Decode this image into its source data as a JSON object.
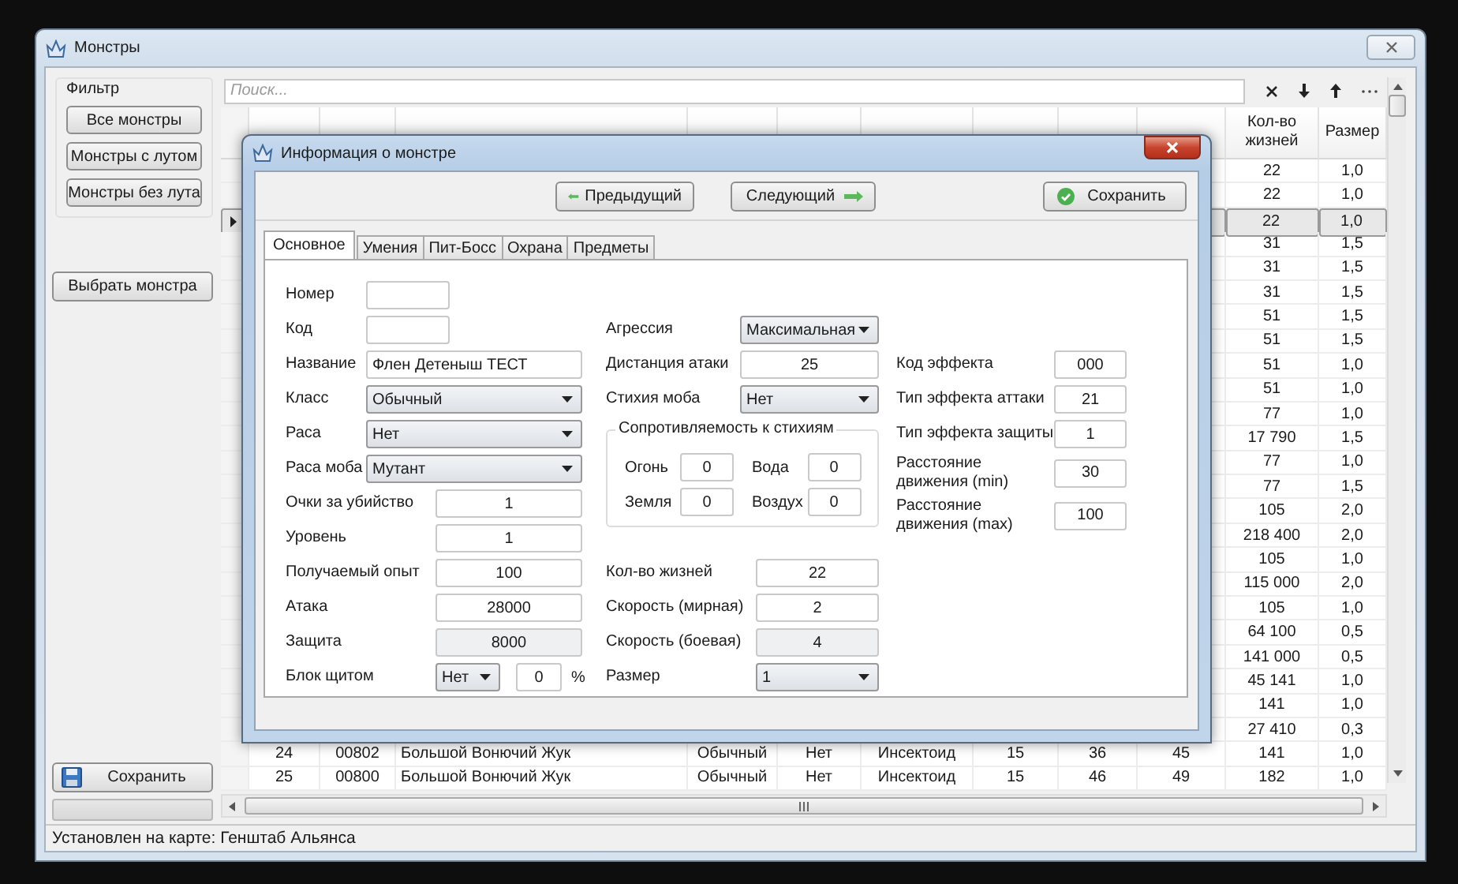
{
  "window": {
    "title": "Монстры"
  },
  "filter": {
    "title": "Фильтр",
    "buttons": [
      "Все монстры",
      "Монстры с лутом",
      "Монстры без лута"
    ]
  },
  "select_button": "Выбрать монстра",
  "save_button": "Сохранить",
  "progress": {
    "level": 0
  },
  "search": {
    "placeholder": "Поиск..."
  },
  "table": {
    "columns": [
      "Кол-во жизней",
      "Размер"
    ],
    "rows": [
      {
        "selected": false,
        "cells": [
          "22",
          "1,0"
        ]
      },
      {
        "selected": false,
        "cells": [
          "22",
          "1,0"
        ]
      },
      {
        "selected": true,
        "cells": [
          "22",
          "1,0"
        ]
      },
      {
        "selected": false,
        "cells": [
          "31",
          "1,5"
        ]
      },
      {
        "selected": false,
        "cells": [
          "31",
          "1,5"
        ]
      },
      {
        "selected": false,
        "cells": [
          "31",
          "1,5"
        ]
      },
      {
        "selected": false,
        "cells": [
          "51",
          "1,5"
        ]
      },
      {
        "selected": false,
        "cells": [
          "51",
          "1,5"
        ]
      },
      {
        "selected": false,
        "cells": [
          "51",
          "1,0"
        ]
      },
      {
        "selected": false,
        "cells": [
          "51",
          "1,0"
        ]
      },
      {
        "selected": false,
        "cells": [
          "77",
          "1,0"
        ]
      },
      {
        "selected": false,
        "cells": [
          "17 790",
          "1,5"
        ]
      },
      {
        "selected": false,
        "cells": [
          "77",
          "1,0"
        ]
      },
      {
        "selected": false,
        "cells": [
          "77",
          "1,5"
        ]
      },
      {
        "selected": false,
        "cells": [
          "105",
          "2,0"
        ]
      },
      {
        "selected": false,
        "cells": [
          "218 400",
          "2,0"
        ]
      },
      {
        "selected": false,
        "cells": [
          "105",
          "1,0"
        ]
      },
      {
        "selected": false,
        "cells": [
          "115 000",
          "2,0"
        ]
      },
      {
        "selected": false,
        "cells": [
          "105",
          "1,0"
        ]
      },
      {
        "selected": false,
        "cells": [
          "64 100",
          "0,5"
        ]
      },
      {
        "selected": false,
        "cells": [
          "141 000",
          "0,5"
        ]
      },
      {
        "selected": false,
        "cells": [
          "45 141",
          "1,0"
        ]
      },
      {
        "selected": false,
        "cells": [
          "141",
          "1,0"
        ]
      },
      {
        "selected": false,
        "cells": [
          "27 410",
          "0,3"
        ]
      },
      {
        "selected": false,
        "cells": [
          "24",
          "00802",
          "Большой Вонючий Жук",
          "Обычный",
          "Нет",
          "Инсектоид",
          "15",
          "36",
          "45",
          "141",
          "1,0"
        ]
      },
      {
        "selected": false,
        "cells": [
          "25",
          "00800",
          "Большой Вонючий Жук",
          "Обычный",
          "Нет",
          "Инсектоид",
          "15",
          "46",
          "49",
          "182",
          "1,0"
        ]
      }
    ]
  },
  "status_bar": "Установлен на карте: Генштаб Альянса",
  "dialog": {
    "title": "Информация о монстре",
    "prev_button": "Предыдущий",
    "next_button": "Следующий",
    "save_button": "Сохранить",
    "tabs": [
      {
        "label": "Основное",
        "selected": true
      },
      {
        "label": "Умения",
        "selected": false
      },
      {
        "label": "Пит-Босс",
        "selected": false
      },
      {
        "label": "Охрана",
        "selected": false
      },
      {
        "label": "Предметы",
        "selected": false
      }
    ],
    "identity": [
      {
        "kind": "short_input",
        "label": "Номер",
        "readonly": false
      },
      {
        "kind": "short_input",
        "label": "Код",
        "readonly": false
      },
      {
        "kind": "input",
        "label": "Название",
        "value": "Флен Детеныш ТЕСТ",
        "readonly": false
      },
      {
        "kind": "select",
        "label": "Класс",
        "value": "Обычный"
      },
      {
        "kind": "select",
        "label": "Раса",
        "value": "Нет"
      },
      {
        "kind": "select",
        "label": "Раса моба",
        "value": "Мутант"
      }
    ],
    "stats": [
      {
        "kind": "input",
        "label": "Очки за убийство",
        "value": "1",
        "readonly": false
      },
      {
        "kind": "input",
        "label": "Уровень",
        "value": "1",
        "readonly": false
      },
      {
        "kind": "input",
        "label": "Получаемый опыт",
        "value": "100",
        "readonly": false
      },
      {
        "kind": "input",
        "label": "Атака",
        "value": "28000",
        "readonly": false
      },
      {
        "kind": "input",
        "label": "Защита",
        "value": "8000",
        "readonly": true
      },
      {
        "kind": "shield",
        "label": "Блок щитом",
        "option": "Нет",
        "value": "0",
        "unit": "%"
      }
    ],
    "combat": [
      {
        "kind": "select",
        "label": "Агрессия",
        "value": "Максимальная"
      },
      {
        "kind": "input",
        "label": "Дистанция атаки",
        "value": "25",
        "readonly": false
      },
      {
        "kind": "select",
        "label": "Стихия моба",
        "value": "Нет"
      }
    ],
    "resistance": {
      "title": "Сопротивляемость к стихиям",
      "fields": [
        {
          "label": "Огонь",
          "value": "0"
        },
        {
          "label": "Вода",
          "value": "0"
        },
        {
          "label": "Земля",
          "value": "0"
        },
        {
          "label": "Воздух",
          "value": "0"
        }
      ]
    },
    "vitals": [
      {
        "kind": "input",
        "label": "Кол-во жизней",
        "value": "22",
        "readonly": false
      },
      {
        "kind": "input",
        "label": "Скорость (мирная)",
        "value": "2",
        "readonly": false
      },
      {
        "kind": "input",
        "label": "Скорость (боевая)",
        "value": "4",
        "readonly": true
      },
      {
        "kind": "select",
        "label": "Размер",
        "value": "1"
      }
    ],
    "effects": [
      {
        "kind": "input",
        "label": "Код эффекта",
        "value": "000",
        "readonly": false
      },
      {
        "kind": "input",
        "label": "Тип эффекта аттаки",
        "value": "21",
        "readonly": false
      },
      {
        "kind": "input",
        "label": "Тип эффекта защиты",
        "value": "1",
        "readonly": false
      },
      {
        "kind": "input",
        "label": "Расстояние движения (min)",
        "value": "30",
        "readonly": false
      },
      {
        "kind": "input",
        "label": "Расстояние движения (max)",
        "value": "100",
        "readonly": false
      }
    ]
  }
}
